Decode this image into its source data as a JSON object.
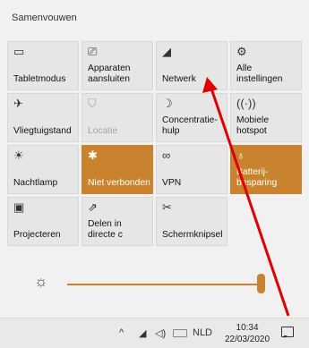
{
  "header": {
    "collapse_label": "Samenvouwen"
  },
  "tiles": [
    {
      "label": [
        "Tabletmodus"
      ],
      "icon": "▭",
      "state": "normal"
    },
    {
      "label": [
        "Apparaten",
        "aansluiten"
      ],
      "icon": "⎚",
      "state": "normal"
    },
    {
      "label": [
        "Netwerk"
      ],
      "icon": "◢",
      "state": "normal"
    },
    {
      "label": [
        "Alle",
        "instellingen"
      ],
      "icon": "⚙",
      "state": "normal"
    },
    {
      "label": [
        "Vliegtuigstand"
      ],
      "icon": "✈",
      "state": "normal"
    },
    {
      "label": [
        "Locatie"
      ],
      "icon": "⛉",
      "state": "disabled"
    },
    {
      "label": [
        "Concentratie-",
        "hulp"
      ],
      "icon": "☽",
      "state": "normal"
    },
    {
      "label": [
        "Mobiele",
        "hotspot"
      ],
      "icon": "((·))",
      "state": "normal"
    },
    {
      "label": [
        "Nachtlamp"
      ],
      "icon": "☀",
      "state": "normal"
    },
    {
      "label": [
        "Niet verbonden"
      ],
      "icon": "✱",
      "state": "active"
    },
    {
      "label": [
        "VPN"
      ],
      "icon": "∞",
      "state": "normal"
    },
    {
      "label": [
        "Batterij-",
        "besparing"
      ],
      "icon": "♁",
      "state": "active"
    },
    {
      "label": [
        "Projecteren"
      ],
      "icon": "▣",
      "state": "normal"
    },
    {
      "label": [
        "Delen in",
        "directe c"
      ],
      "icon": "⇗",
      "state": "normal"
    },
    {
      "label": [
        "Schermknipsel"
      ],
      "icon": "✂",
      "state": "normal"
    }
  ],
  "brightness": {
    "icon": "☼",
    "level_percent": 100
  },
  "taskbar": {
    "chevron": "^",
    "wifi_icon": "◢",
    "volume_icon": "◁)",
    "language": "NLD",
    "time": "10:34",
    "date": "22/03/2020"
  },
  "colors": {
    "accent": "#c9832e",
    "annotation_arrow": "#e00000"
  }
}
